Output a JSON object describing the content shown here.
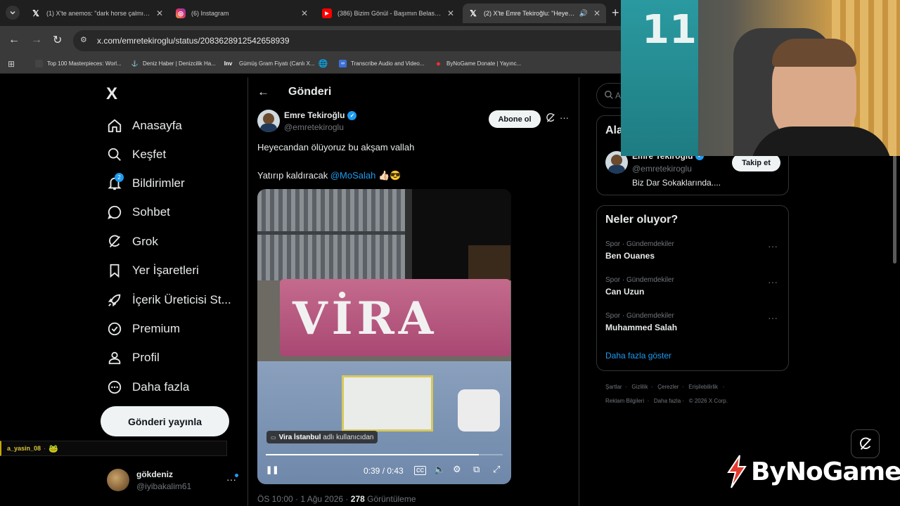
{
  "browser": {
    "tabs": [
      {
        "title": "(1) X'te anemos: \"dark horse çalmışlar. kli..",
        "favicon": "x-icon",
        "active": false
      },
      {
        "title": "(6) Instagram",
        "favicon": "instagram-icon",
        "active": false
      },
      {
        "title": "(386) Bizim Gönül - Başımın Belası ✓ - Yo...",
        "favicon": "youtube-icon",
        "active": false
      },
      {
        "title": "(2) X'te Emre Tekiroğlu: \"Heyecandan...",
        "favicon": "x-icon",
        "active": true
      }
    ],
    "url": "x.com/emretekiroglu/status/2083628912542658939",
    "bookmarks": [
      {
        "label": "Top 100 Masterpieces: Worl..."
      },
      {
        "label": "Deniz Haber | Denizcilik Ha..."
      },
      {
        "label": "Gümüş Gram Fiyatı (Canlı X..."
      },
      {
        "label": ""
      },
      {
        "label": "Transcribe Audio and Video..."
      },
      {
        "label": "ByNoGame Donate | Yayınc..."
      }
    ]
  },
  "sidebar": {
    "logo": "X",
    "items": [
      {
        "label": "Anasayfa",
        "icon": "home-icon"
      },
      {
        "label": "Keşfet",
        "icon": "search-icon"
      },
      {
        "label": "Bildirimler",
        "icon": "bell-icon",
        "badge": "2"
      },
      {
        "label": "Sohbet",
        "icon": "chat-icon"
      },
      {
        "label": "Grok",
        "icon": "grok-icon"
      },
      {
        "label": "Yer İşaretleri",
        "icon": "bookmark-icon"
      },
      {
        "label": "İçerik Üreticisi St...",
        "icon": "rocket-icon"
      },
      {
        "label": "Premium",
        "icon": "premium-icon"
      },
      {
        "label": "Profil",
        "icon": "person-icon"
      },
      {
        "label": "Daha fazla",
        "icon": "more-circle-icon"
      }
    ],
    "post_button": "Gönderi yayınla",
    "account": {
      "name": "gökdeniz",
      "handle": "@iyibakalim61"
    }
  },
  "chat_overlay": {
    "user": "a_yasin_08",
    "separator": "·"
  },
  "post": {
    "header_title": "Gönderi",
    "author_name": "Emre Tekiroğlu",
    "author_handle": "@emretekiroglu",
    "subscribe_label": "Abone ol",
    "text_line1": "Heyecandan ölüyoruz bu akşam vallah",
    "text_line2_prefix": "Yatırıp kaldıracak ",
    "mention": "@MoSalah",
    "emojis": "👍🏻😎",
    "video": {
      "attribution_name": "Vira İstanbul",
      "attribution_suffix": "adlı kullanıcıdan",
      "current_time": "0:39",
      "total_time": "0:43",
      "progress": 0.9
    },
    "meta_time": "ÖS 10:00 · 1 Ağu 2026 · ",
    "views_count": "278",
    "views_label": " Görüntüleme"
  },
  "right": {
    "search_placeholder": "A",
    "who_to_follow": {
      "title": "Ala",
      "name": "Emre Tekiroğlu",
      "handle": "@emretekiroglu",
      "follow_label": "Takip et",
      "bio": "Biz Dar Sokaklarında...."
    },
    "trends": {
      "title": "Neler oluyor?",
      "items": [
        {
          "category": "Spor · Gündemdekiler",
          "name": "Ben Ouanes"
        },
        {
          "category": "Spor · Gündemdekiler",
          "name": "Can Uzun"
        },
        {
          "category": "Spor · Gündemdekiler",
          "name": "Muhammed Salah"
        }
      ],
      "show_more": "Daha fazla göster"
    },
    "footer_line1": [
      "Şartlar",
      "Gizlilik",
      "Çerezler",
      "Erişilebilirlik",
      "·"
    ],
    "footer_line2": [
      "Reklam Bilgileri",
      "Daha fazla ·",
      "© 2026 X Corp."
    ]
  },
  "webcam": {
    "jersey_number": "11"
  },
  "watermark": {
    "brand": "ByNoGame"
  },
  "colors": {
    "accent": "#1d9bf0",
    "bg": "#000000",
    "border": "#2f3336",
    "muted": "#71767b"
  }
}
